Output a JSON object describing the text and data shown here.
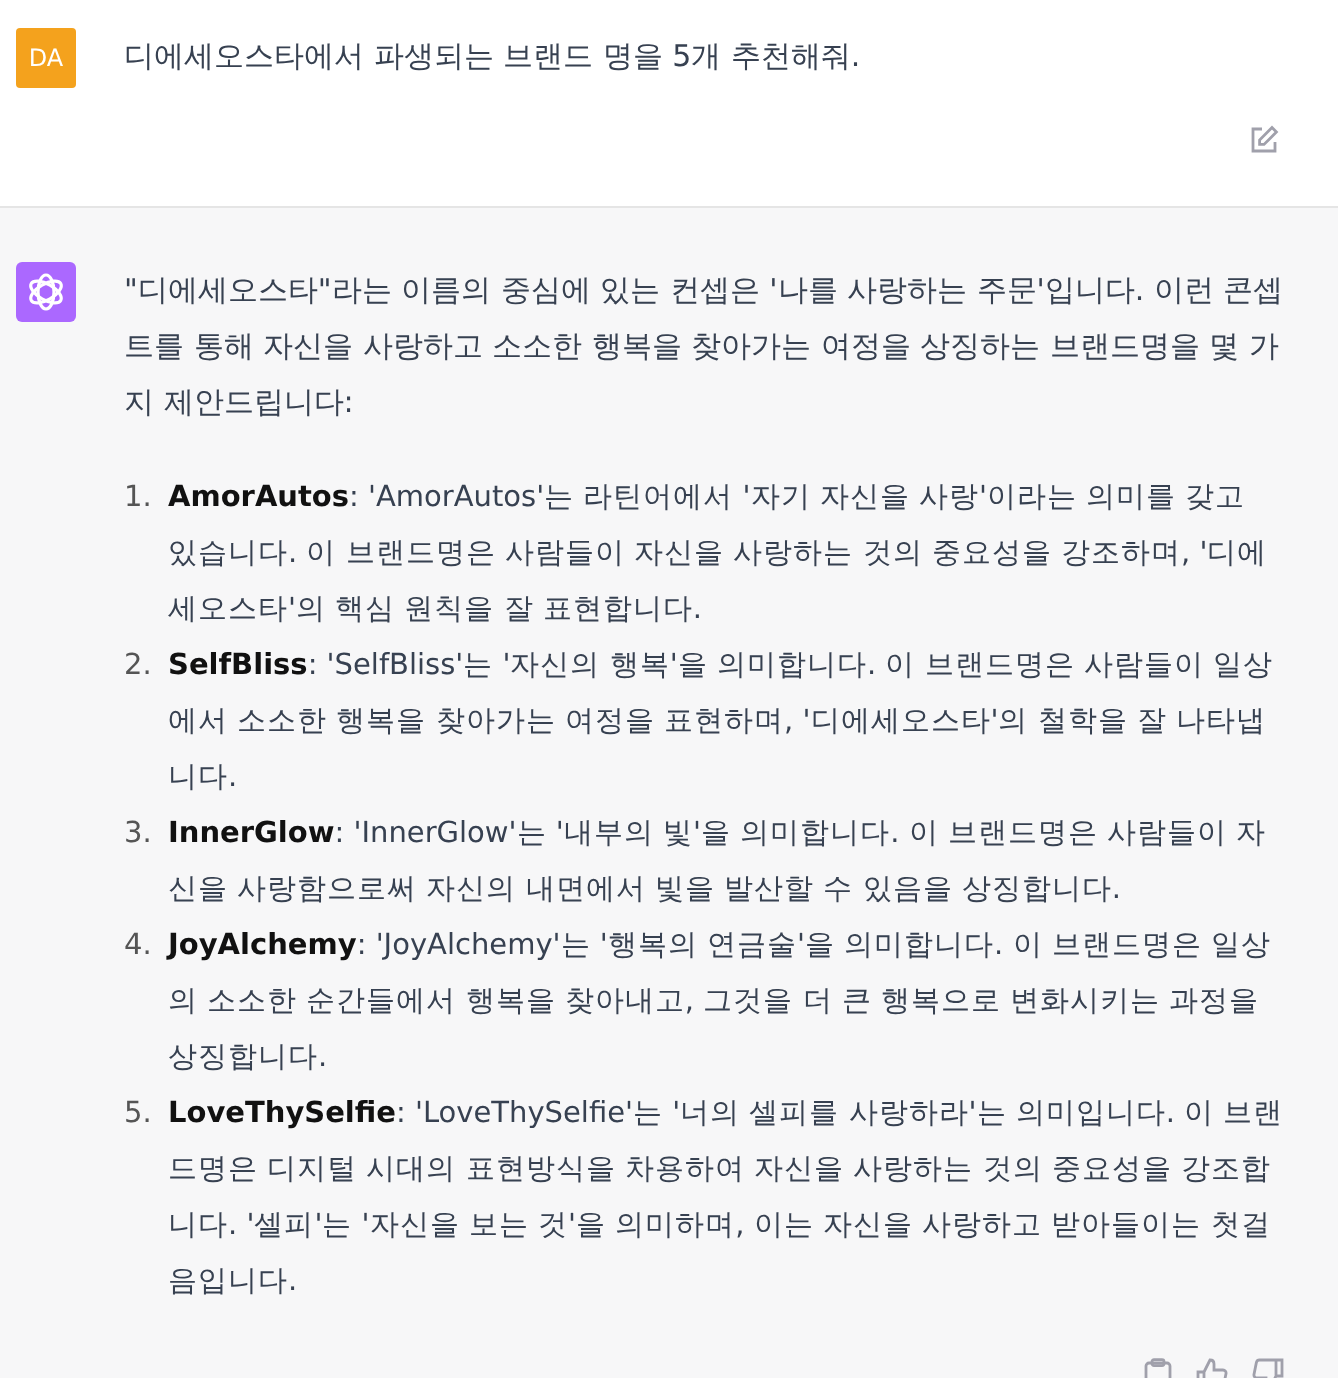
{
  "user_message": {
    "avatar": "DA",
    "text": "디에세오스타에서 파생되는 브랜드 명을 5개 추천해줘."
  },
  "assistant_message": {
    "intro": "\"디에세오스타\"라는 이름의 중심에 있는 컨셉은 '나를 사랑하는 주문'입니다. 이런 콘셉트를 통해 자신을 사랑하고 소소한 행복을 찾아가는 여정을 상징하는 브랜드명을 몇 가지 제안드립니다:",
    "items": [
      {
        "number": "1.",
        "name": "AmorAutos",
        "text": ": 'AmorAutos'는 라틴어에서 '자기 자신을 사랑'이라는 의미를 갖고 있습니다. 이 브랜드명은 사람들이 자신을 사랑하는 것의 중요성을 강조하며, '디에세오스타'의 핵심 원칙을 잘 표현합니다."
      },
      {
        "number": "2.",
        "name": "SelfBliss",
        "text": ": 'SelfBliss'는 '자신의 행복'을 의미합니다. 이 브랜드명은 사람들이 일상에서 소소한 행복을 찾아가는 여정을 표현하며, '디에세오스타'의 철학을 잘 나타냅니다."
      },
      {
        "number": "3.",
        "name": "InnerGlow",
        "text": ": 'InnerGlow'는 '내부의 빛'을 의미합니다. 이 브랜드명은 사람들이 자신을 사랑함으로써 자신의 내면에서 빛을 발산할 수 있음을 상징합니다."
      },
      {
        "number": "4.",
        "name": "JoyAlchemy",
        "text": ": 'JoyAlchemy'는 '행복의 연금술'을 의미합니다. 이 브랜드명은 일상의 소소한 순간들에서 행복을 찾아내고, 그것을 더 큰 행복으로 변화시키는 과정을 상징합니다."
      },
      {
        "number": "5.",
        "name": "LoveThySelfie",
        "text": ": 'LoveThySelfie'는 '너의 셀피를 사랑하라'는 의미입니다. 이 브랜드명은 디지털 시대의 표현방식을 차용하여 자신을 사랑하는 것의 중요성을 강조합니다. '셀피'는 '자신을 보는 것'을 의미하며, 이는 자신을 사랑하고 받아들이는 첫걸음입니다."
      }
    ]
  }
}
